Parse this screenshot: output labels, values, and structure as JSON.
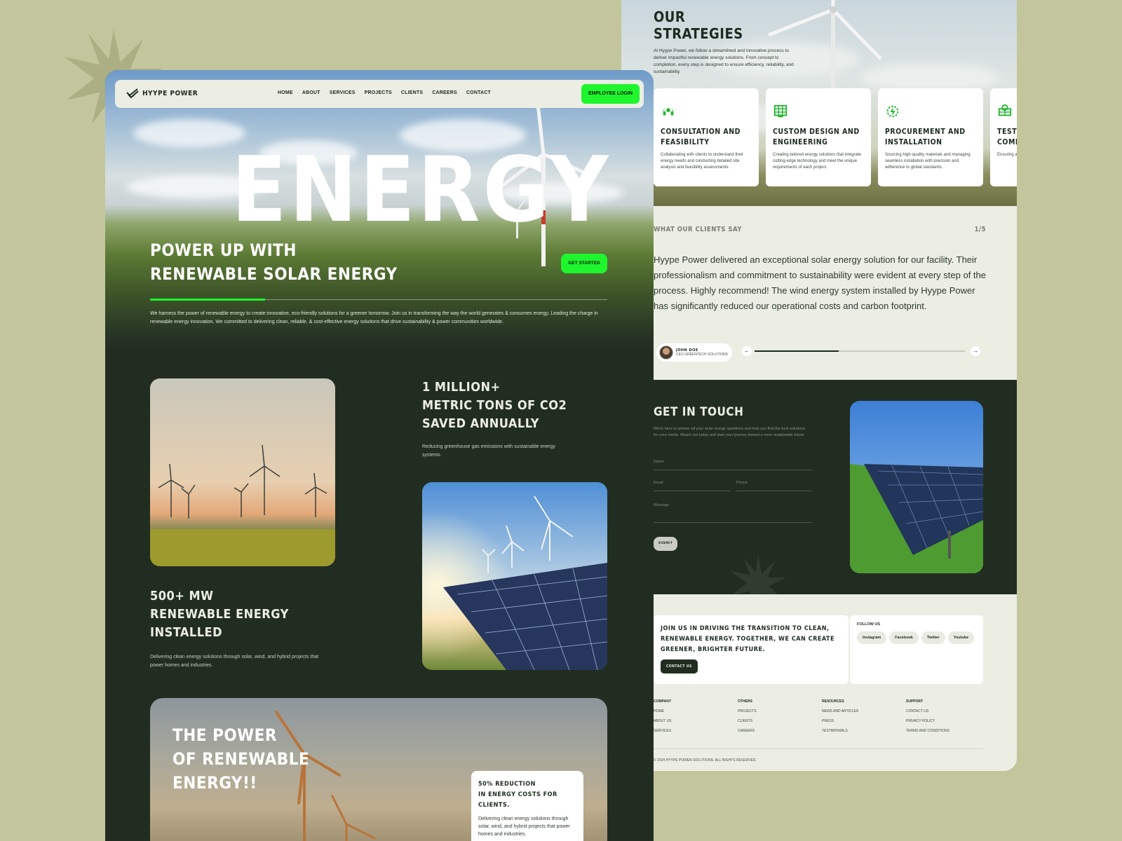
{
  "nav": {
    "brand": "HYYPE POWER",
    "items": [
      "HOME",
      "ABOUT",
      "SERVICES",
      "PROJECTS",
      "CLIENTS",
      "CAREERS",
      "CONTACT"
    ],
    "login_label": "EMPLOYEE LOGIN"
  },
  "hero": {
    "big_word": "ENERGY",
    "headline_line1": "POWER UP WITH",
    "headline_line2": "RENEWABLE SOLAR ENERGY",
    "cta_label": "GET STARTED",
    "paragraph": "We harness the power of renewable energy to create innovative, eco-friendly solutions for a greener tomorrow. Join us in transforming the way the world generates & consumes energy. Leading the charge in renewable energy innovation, We committed to delivering clean, reliable, & cost-effective energy solutions that drive sustainability & power communities worldwide."
  },
  "stats": [
    {
      "line1": "1 MILLION+",
      "line2": "METRIC TONS OF CO2",
      "line3": "SAVED ANNUALLY",
      "desc": "Reducing greenhouse gas emissions with sustainable energy systems."
    },
    {
      "line1": "500+ MW",
      "line2": "RENEWABLE ENERGY",
      "line3": "INSTALLED",
      "desc": "Delivering clean energy solutions through solar, wind, and hybrid projects that power homes and industries."
    }
  ],
  "banner": {
    "line1": "THE POWER",
    "line2": "OF RENEWABLE",
    "line3": "ENERGY!!",
    "card_title1": "50% REDUCTION",
    "card_title2": "IN ENERGY COSTS FOR CLIENTS.",
    "card_text": "Delivering clean energy solutions through solar, wind, and hybrid projects that power homes and industries."
  },
  "strategies": {
    "title1": "OUR",
    "title2": "STRATEGIES",
    "intro": "At Hyype Power, we follow a streamlined and innovative process to deliver impactful renewable energy solutions. From concept to completion, every step is designed to ensure efficiency, reliability, and sustainability.",
    "cards": [
      {
        "title1": "CONSULTATION AND",
        "title2": "FEASIBILITY",
        "text": "Collaborating with clients to understand their energy needs and conducting detailed site analysis and feasibility assessments.",
        "icon": "headset-icon"
      },
      {
        "title1": "CUSTOM DESIGN AND",
        "title2": "ENGINEERING",
        "text": "Creating tailored energy solutions that integrate cutting-edge technology and meet the unique requirements of each project.",
        "icon": "solar-panel-icon"
      },
      {
        "title1": "PROCUREMENT AND",
        "title2": "INSTALLATION",
        "text": "Sourcing high-quality materials and managing seamless installation with precision and adherence to global standards.",
        "icon": "bolt-gear-icon"
      },
      {
        "title1": "TESTI",
        "title2": "COMM",
        "text": "Ensuring a operationa day one.",
        "icon": "solar-monitor-icon"
      }
    ]
  },
  "testimonial": {
    "label": "WHAT OUR CLIENTS SAY",
    "counter": "1/5",
    "quote": "Hyype Power delivered an exceptional solar energy solution for our facility. Their professionalism and commitment to sustainability were evident at every step of the process. Highly recommend! The wind energy system installed by Hyype Power has significantly reduced our operational costs and carbon footprint.",
    "name": "JOHN DOE",
    "role": "CEO GREENTECH SOLUTIONS",
    "prev": "←",
    "next": "→",
    "progress": 0.4
  },
  "contact": {
    "title": "GET IN TOUCH",
    "desc": "We're here to answer all your solar energy questions and help you find the best solutions for your needs. Reach out today and start your journey toward a more sustainable future.",
    "name_placeholder": "Name",
    "email_placeholder": "Email",
    "phone_placeholder": "Phone",
    "message_placeholder": "Message",
    "submit_label": "SUBMIT"
  },
  "footer": {
    "cta_text": "JOIN US IN DRIVING THE TRANSITION TO CLEAN, RENEWABLE ENERGY. TOGETHER, WE CAN CREATE GREENER, BRIGHTER FUTURE.",
    "cta_button": "CONTACT US",
    "follow_label": "FOLLOW US",
    "socials": [
      "Instagram",
      "Facebook",
      "Twitter",
      "Youtube"
    ],
    "columns": [
      {
        "heading": "COMPANY",
        "links": [
          "HOME",
          "ABOUT US",
          "SERVICES"
        ]
      },
      {
        "heading": "OTHERS",
        "links": [
          "PROJECTS",
          "CLIENTS",
          "CAREERS"
        ]
      },
      {
        "heading": "RESOURCES",
        "links": [
          "NEWS AND ARTICLES",
          "PRESS",
          "TESTIMONIALS"
        ]
      },
      {
        "heading": "SUPPORT",
        "links": [
          "CONTACT US",
          "PRIVACY POLICY",
          "TERMS AND CONDITIONS"
        ]
      }
    ],
    "copyright": "© 2024 HYYPE POWER SOLUTIONS. ALL RIGHTS RESERVED."
  },
  "colors": {
    "accent": "#1ef52d",
    "dark": "#222d21",
    "light": "#eceee3",
    "page_bg": "#c3c69d"
  }
}
